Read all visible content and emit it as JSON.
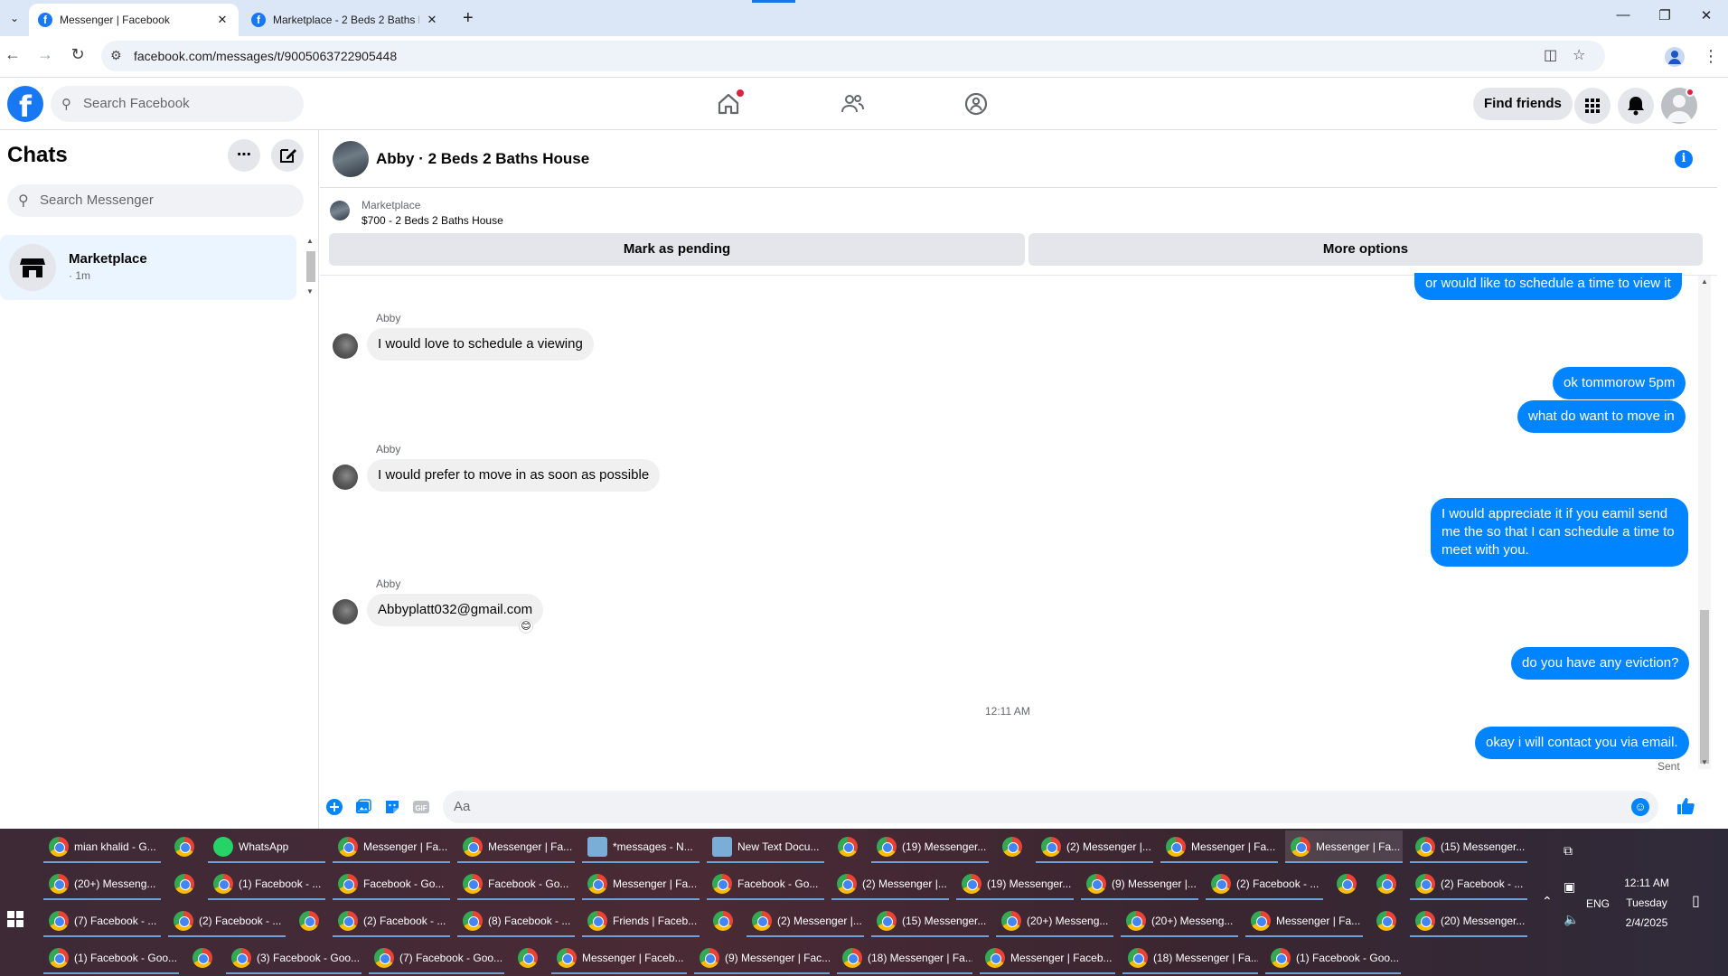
{
  "browser": {
    "tabs": [
      {
        "title": "Messenger | Facebook",
        "active": true
      },
      {
        "title": "Marketplace - 2 Beds 2 Baths H",
        "active": false
      }
    ],
    "url": "facebook.com/messages/t/9005063722905448"
  },
  "fb": {
    "logo": "f",
    "search_placeholder": "Search Facebook",
    "find_friends": "Find friends"
  },
  "sidebar": {
    "title": "Chats",
    "search_placeholder": "Search Messenger",
    "chat": {
      "name": "Marketplace",
      "meta": "· 1m"
    }
  },
  "conversation": {
    "title": "Abby · 2 Beds 2 Baths House",
    "marketplace_label": "Marketplace",
    "listing": "$700 - 2 Beds 2 Baths House",
    "mark_pending": "Mark as pending",
    "more_options": "More options",
    "messages": [
      {
        "from": "me",
        "text": "or would like to schedule a time to view it"
      },
      {
        "from": "Abby",
        "text": "I would love to schedule a viewing"
      },
      {
        "from": "me",
        "text": "ok tommorow 5pm"
      },
      {
        "from": "me",
        "text": "what do want to move in"
      },
      {
        "from": "Abby",
        "text": "I would prefer to move in as soon as possible"
      },
      {
        "from": "me",
        "text": "I would appreciate it if you eamil send me the so that I can schedule a time to meet with you."
      },
      {
        "from": "Abby",
        "text": "Abbyplatt032@gmail.com"
      },
      {
        "from": "me",
        "text": "do you have any eviction?"
      },
      {
        "from": "me",
        "text": "okay i will contact you via email."
      }
    ],
    "sender_name": "Abby",
    "timestamp": "12:11 AM",
    "status": "Sent",
    "composer_placeholder": "Aa"
  },
  "taskbar": {
    "row1": [
      "mian khalid - G...",
      "",
      "WhatsApp",
      "Messenger | Fa...",
      "Messenger | Fa...",
      "*messages - N...",
      "New Text Docu...",
      "",
      "(19) Messenger...",
      "",
      "(2) Messenger |...",
      "Messenger | Fa...",
      "Messenger | Fa...",
      "(15) Messenger..."
    ],
    "row2": [
      "(20+) Messeng...",
      "",
      "(1) Facebook - ...",
      "Facebook - Go...",
      "Facebook - Go...",
      "Messenger | Fa...",
      "Facebook - Go...",
      "(2) Messenger |...",
      "(19) Messenger...",
      "(9) Messenger |...",
      "(2) Facebook - ...",
      "",
      "",
      "(2) Facebook - ..."
    ],
    "row3": [
      "(7) Facebook - ...",
      "(2) Facebook - ...",
      "",
      "(2) Facebook - ...",
      "(8) Facebook - ...",
      "Friends | Faceb...",
      "",
      "(2) Messenger |...",
      "(15) Messenger...",
      "(20+) Messeng...",
      "(20+) Messeng...",
      "Messenger | Fa...",
      "",
      "(20) Messenger..."
    ],
    "row4": [
      "(1) Facebook - Goo...",
      "",
      "(3) Facebook - Goo...",
      "(7) Facebook - Goo...",
      "",
      "Messenger | Faceb...",
      "(9) Messenger | Fac...",
      "(18) Messenger | Fa...",
      "Messenger | Faceb...",
      "(18) Messenger | Fa...",
      "(1) Facebook - Goo..."
    ],
    "tray": {
      "lang": "ENG",
      "time": "12:11 AM",
      "day": "Tuesday",
      "date": "2/4/2025"
    }
  }
}
